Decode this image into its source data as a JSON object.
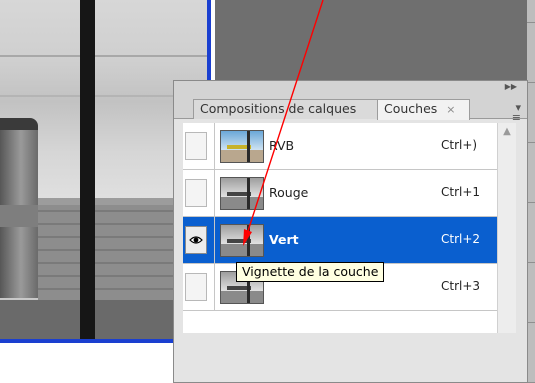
{
  "panel": {
    "tabs": [
      {
        "label": "Compositions de calques",
        "active": false
      },
      {
        "label": "Couches",
        "active": true,
        "close": "×"
      }
    ],
    "collapse_icon": "double-chevron-right-icon",
    "menu_icon": "panel-menu-icon"
  },
  "channels": [
    {
      "name": "RVB",
      "shortcut": "Ctrl+)",
      "visible": false,
      "selected": false,
      "thumb": "color"
    },
    {
      "name": "Rouge",
      "shortcut": "Ctrl+1",
      "visible": false,
      "selected": false,
      "thumb": "gray"
    },
    {
      "name": "Vert",
      "shortcut": "Ctrl+2",
      "visible": true,
      "selected": true,
      "thumb": "gray"
    },
    {
      "name": "",
      "shortcut": "Ctrl+3",
      "visible": false,
      "selected": false,
      "thumb": "gray"
    }
  ],
  "tooltip": "Vignette de la couche",
  "colors": {
    "selection": "#0a5fcf",
    "document_border": "#1a3fd0",
    "annotation_arrow": "#ff0000"
  }
}
